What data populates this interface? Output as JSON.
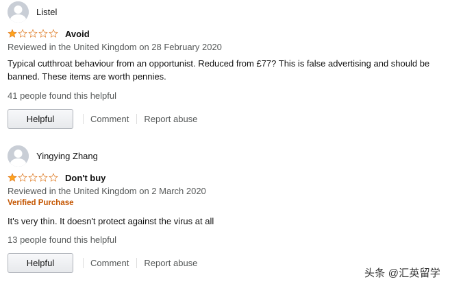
{
  "reviews": [
    {
      "author": "Listel",
      "rating": 1,
      "max_rating": 5,
      "headline": "Avoid",
      "meta": "Reviewed in the United Kingdom on 28 February 2020",
      "verified": "",
      "body": "Typical cutthroat behaviour from an opportunist. Reduced from £77? This is false advertising and should be banned. These items are worth pennies.",
      "helpful_count": "41 people found this helpful",
      "helpful_label": "Helpful",
      "comment_label": "Comment",
      "report_label": "Report abuse"
    },
    {
      "author": "Yingying Zhang",
      "rating": 1,
      "max_rating": 5,
      "headline": "Don't buy",
      "meta": "Reviewed in the United Kingdom on 2 March 2020",
      "verified": "Verified Purchase",
      "body": "It's very thin. It doesn't protect against the virus at all",
      "helpful_count": "13 people found this helpful",
      "helpful_label": "Helpful",
      "comment_label": "Comment",
      "report_label": "Report abuse"
    }
  ],
  "watermark": "头条 @汇英留学",
  "colors": {
    "star_fill": "#ffa41c",
    "star_outline": "#de7921",
    "verified": "#c45500",
    "muted_text": "#565959"
  }
}
